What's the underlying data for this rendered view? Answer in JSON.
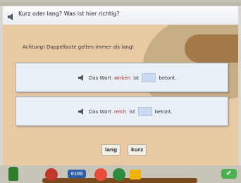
{
  "header": {
    "question": "Kurz oder lang? Was ist hier richtig?"
  },
  "play": {
    "note": "Achtung! Doppellaute gelten immer als lang!",
    "cards": [
      {
        "prefix": "Das Wort",
        "word": "wirken",
        "middle": "ist",
        "suffix": "betont."
      },
      {
        "prefix": "Das Wort",
        "word": "reich",
        "middle": "ist",
        "suffix": "betont."
      }
    ],
    "buttons": {
      "lang": "lang",
      "kurz": "kurz"
    }
  },
  "toolbar": {
    "counter": "0100",
    "ok_symbol": "✔"
  },
  "colors": {
    "accent_word": "#b22b23",
    "answer_blank": "#c9d9ef",
    "play_background": "#e8c9a4"
  },
  "icons": [
    "speaker-icon",
    "exit-icon",
    "hand-icon",
    "counter-icon",
    "gauge-icon",
    "green-icon",
    "bars-icon",
    "check-icon"
  ]
}
